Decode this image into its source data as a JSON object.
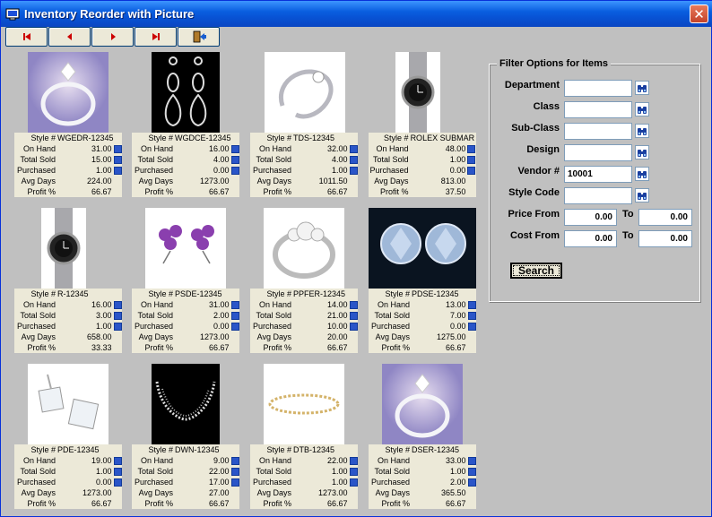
{
  "window": {
    "title": "Inventory Reorder with Picture",
    "close_label": "✕"
  },
  "labels": {
    "style": "Style #",
    "on_hand": "On Hand",
    "total_sold": "Total Sold",
    "purchased": "Purchased",
    "avg_days": "Avg Days",
    "profit": "Profit %"
  },
  "items": [
    {
      "style": "WGEDR-12345",
      "on_hand": "31.00",
      "total_sold": "15.00",
      "purchased": "1.00",
      "avg_days": "224.00",
      "profit": "66.67",
      "pic": "ring"
    },
    {
      "style": "WGDCE-12345",
      "on_hand": "16.00",
      "total_sold": "4.00",
      "purchased": "0.00",
      "avg_days": "1273.00",
      "profit": "66.67",
      "pic": "earrings-drop"
    },
    {
      "style": "TDS-12345",
      "on_hand": "32.00",
      "total_sold": "4.00",
      "purchased": "1.00",
      "avg_days": "1011.50",
      "profit": "66.67",
      "pic": "ring-twist"
    },
    {
      "style": "ROLEX SUBMAR",
      "on_hand": "48.00",
      "total_sold": "1.00",
      "purchased": "0.00",
      "avg_days": "813.00",
      "profit": "37.50",
      "pic": "watch"
    },
    {
      "style": "R-12345",
      "on_hand": "16.00",
      "total_sold": "3.00",
      "purchased": "1.00",
      "avg_days": "658.00",
      "profit": "33.33",
      "pic": "watch"
    },
    {
      "style": "PSDE-12345",
      "on_hand": "31.00",
      "total_sold": "2.00",
      "purchased": "0.00",
      "avg_days": "1273.00",
      "profit": "66.67",
      "pic": "flower-earrings"
    },
    {
      "style": "PPFER-12345",
      "on_hand": "14.00",
      "total_sold": "21.00",
      "purchased": "10.00",
      "avg_days": "20.00",
      "profit": "66.67",
      "pic": "ring-three"
    },
    {
      "style": "PDSE-12345",
      "on_hand": "13.00",
      "total_sold": "7.00",
      "purchased": "0.00",
      "avg_days": "1275.00",
      "profit": "66.67",
      "pic": "diamond-studs"
    },
    {
      "style": "PDE-12345",
      "on_hand": "19.00",
      "total_sold": "1.00",
      "purchased": "0.00",
      "avg_days": "1273.00",
      "profit": "66.67",
      "pic": "princess-studs"
    },
    {
      "style": "DWN-12345",
      "on_hand": "9.00",
      "total_sold": "22.00",
      "purchased": "17.00",
      "avg_days": "27.00",
      "profit": "66.67",
      "pic": "necklace"
    },
    {
      "style": "DTB-12345",
      "on_hand": "22.00",
      "total_sold": "1.00",
      "purchased": "1.00",
      "avg_days": "1273.00",
      "profit": "66.67",
      "pic": "bracelet"
    },
    {
      "style": "DSER-12345",
      "on_hand": "33.00",
      "total_sold": "1.00",
      "purchased": "2.00",
      "avg_days": "365.50",
      "profit": "66.67",
      "pic": "ring"
    }
  ],
  "filter": {
    "legend": "Filter Options for Items",
    "department": "Department",
    "class": "Class",
    "subclass": "Sub-Class",
    "design": "Design",
    "vendor": "Vendor #",
    "vendor_value": "10001",
    "style_code": "Style Code",
    "price_from": "Price From",
    "price_from_value": "0.00",
    "price_to": "To",
    "price_to_value": "0.00",
    "cost_from": "Cost From",
    "cost_from_value": "0.00",
    "cost_to": "To",
    "cost_to_value": "0.00",
    "search": "Search"
  },
  "colors": {
    "titlebar": "#0a5fe0",
    "window_bg": "#c0c0c0",
    "cell_bg": "#ece9d8",
    "close": "#c4432a"
  }
}
